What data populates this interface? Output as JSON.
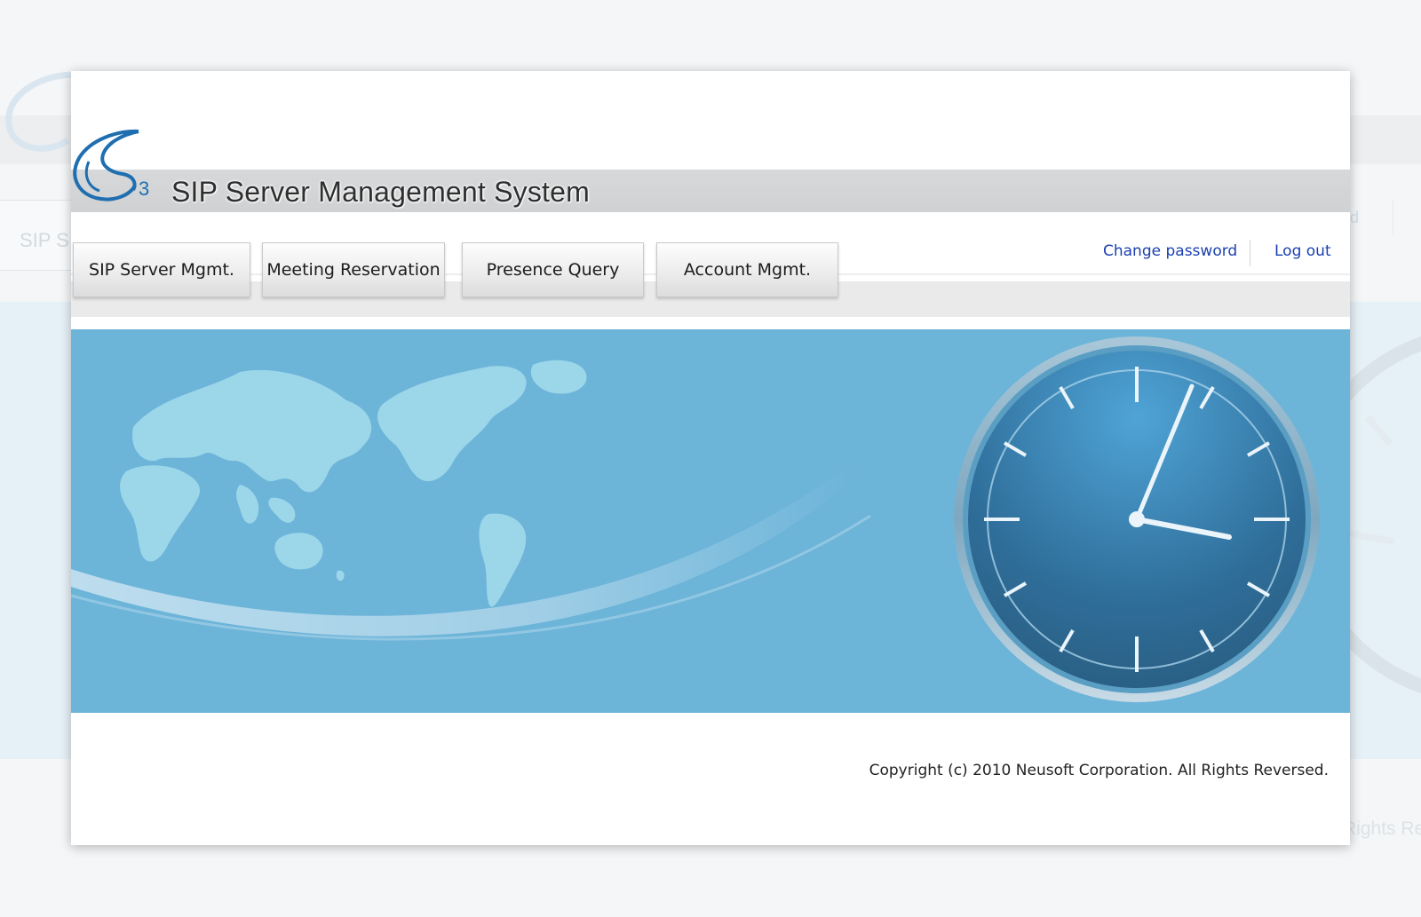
{
  "app": {
    "title": "SIP Server Management System",
    "logo_sub": "3"
  },
  "nav": {
    "tabs": [
      {
        "label": "SIP Server Mgmt."
      },
      {
        "label": "Meeting Reservation"
      },
      {
        "label": "Presence Query"
      },
      {
        "label": "Account Mgmt."
      }
    ]
  },
  "header_links": {
    "change_password": "Change password",
    "log_out": "Log out"
  },
  "footer": {
    "copyright": "Copyright (c) 2010 Neusoft Corporation. All Rights Reversed."
  },
  "background_ghost": {
    "tab_label": "SIP S",
    "copyright_fragment": "Rights Re",
    "link_fragment": "d"
  },
  "colors": {
    "banner": "#6db4d9",
    "title_band": "#d2d4d6",
    "link": "#1a3fb0",
    "clock_face": "#2f6e9a"
  },
  "icons": {
    "logo": "s3-logo",
    "world_map": "world-map-illustration",
    "clock": "analog-clock-icon"
  }
}
